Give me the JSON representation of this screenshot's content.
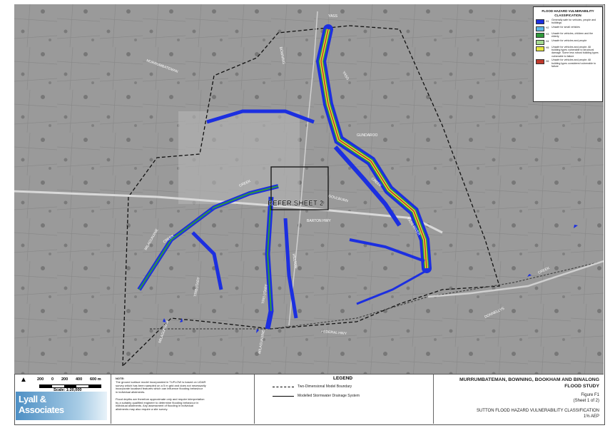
{
  "legend_box": {
    "title": "FLOOD HAZARD VULNERABILITY CLASSIFICATION",
    "classes": [
      {
        "code": "H1",
        "color": "#1c2fe0",
        "text": "Generally safe for vehicles, people and buildings"
      },
      {
        "code": "H2",
        "color": "#5fb8e6",
        "text": "Unsafe for small vehicles"
      },
      {
        "code": "H3",
        "color": "#2e9a3a",
        "text": "Unsafe for vehicles, children and the elderly"
      },
      {
        "code": "H4",
        "color": "#a3d98f",
        "text": "Unsafe for vehicles and people"
      },
      {
        "code": "H5",
        "color": "#e6e640",
        "text": "Unsafe for vehicles and people. All building types vulnerable to structural damage. Some less robust building types vulnerable to failure"
      },
      {
        "code": "H6",
        "color": "#c0392b",
        "text": "Unsafe for vehicles and people. All building types considered vulnerable to failure"
      }
    ]
  },
  "map": {
    "refer_label": "REFER SHEET 2",
    "road_labels": [
      "YASS",
      "MURRUMBATEMAN",
      "BOWNING",
      "CREEK",
      "CREEK",
      "YASS",
      "GOULBURN",
      "MILAGUNJINE",
      "TRIBUTARY",
      "MILAGUNJINE",
      "TRIBUTARY",
      "MILAGUNJINE",
      "CREEK",
      "DONNELLYS",
      "FEDERAL HWY",
      "YASS RIVER",
      "CREEK",
      "BARTON HWY",
      "HILLTON",
      "GUNDAROO"
    ]
  },
  "footer": {
    "scale_ticks": [
      "200",
      "0",
      "200",
      "400",
      "600 m"
    ],
    "scale_label": "Scale: 1:20,000",
    "note_head": "NOTE:",
    "note_lines": [
      "The ground surface model incorporated in TUFLOW is based on LiDAR",
      "survey which has been sampled on a 5 m grid and does not necessarily",
      "incorporate localised features which can influence flooding behaviour",
      "in individual allotments.",
      "",
      "Flood depths are therefore approximate only and require interpretation",
      "by a suitably qualified engineer to determine flooding behaviour in",
      "individual allotments. Any assessment of flooding in individual",
      "allotments may also require a site survey."
    ],
    "logo_line1": "Lyall &",
    "logo_line2": "Associates",
    "legend_title": "LEGEND",
    "legend_items": [
      "Two-Dimensional Model Boundary",
      "Modelled Stormwater Drainage System"
    ],
    "title_line1": "MURRUMBATEMAN, BOWNING, BOOKHAM AND BINALONG",
    "title_line2": "FLOOD STUDY",
    "figure": "Figure F1",
    "sheet": "(Sheet 1 of 2)",
    "subtitle1": "SUTTON FLOOD HAZARD VULNERABILITY CLASSIFICATION",
    "subtitle2": "1% AEP"
  }
}
